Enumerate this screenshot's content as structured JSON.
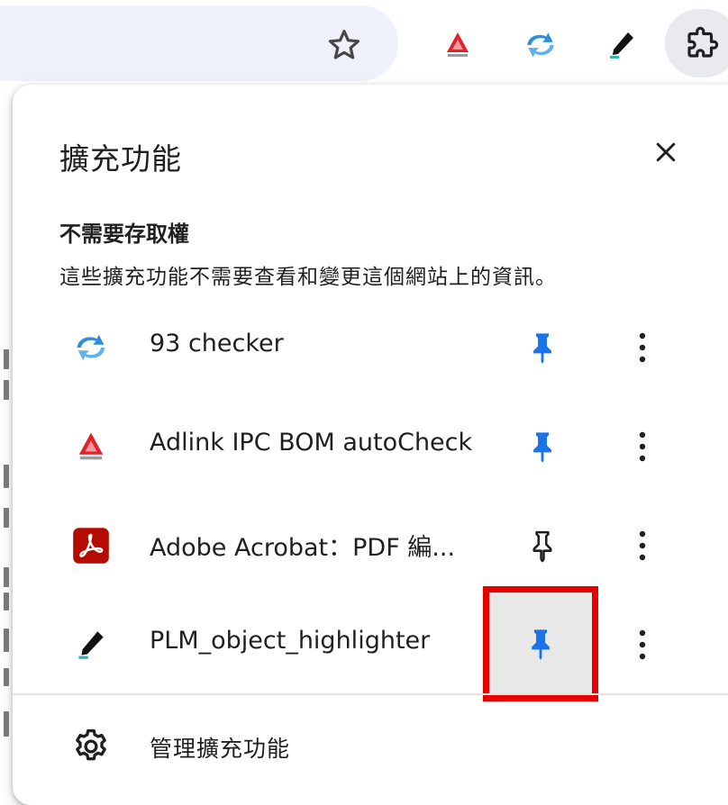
{
  "colors": {
    "accent_blue": "#1a73e8",
    "highlight_red": "#e60000",
    "hover_gray": "#e8e8e8",
    "omnibox_bg": "#eef1f9",
    "adobe_red": "#b30b00"
  },
  "toolbar": {
    "bookmark_icon": "star-icon",
    "extensions_menu_icon": "puzzle-icon",
    "pinned_extensions": [
      {
        "name": "Adlink IPC BOM autoCheck",
        "icon": "adlink-icon"
      },
      {
        "name": "93 checker",
        "icon": "sync-arrows-icon"
      },
      {
        "name": "PLM_object_highlighter",
        "icon": "pen-icon"
      }
    ]
  },
  "popup": {
    "title": "擴充功能",
    "close_icon": "close-icon",
    "section": {
      "heading": "不需要存取權",
      "description": "這些擴充功能不需要查看和變更這個網站上的資訊。"
    },
    "extensions": [
      {
        "name": "93 checker",
        "icon": "sync-arrows-icon",
        "pinned": true
      },
      {
        "name": "Adlink IPC BOM autoCheck",
        "icon": "adlink-icon",
        "pinned": true
      },
      {
        "name": "Adobe Acrobat：PDF 編...",
        "icon": "adobe-acrobat-icon",
        "pinned": false
      },
      {
        "name": "PLM_object_highlighter",
        "icon": "pen-icon",
        "pinned": true
      }
    ],
    "manage": {
      "label": "管理擴充功能",
      "icon": "gear-icon"
    }
  }
}
